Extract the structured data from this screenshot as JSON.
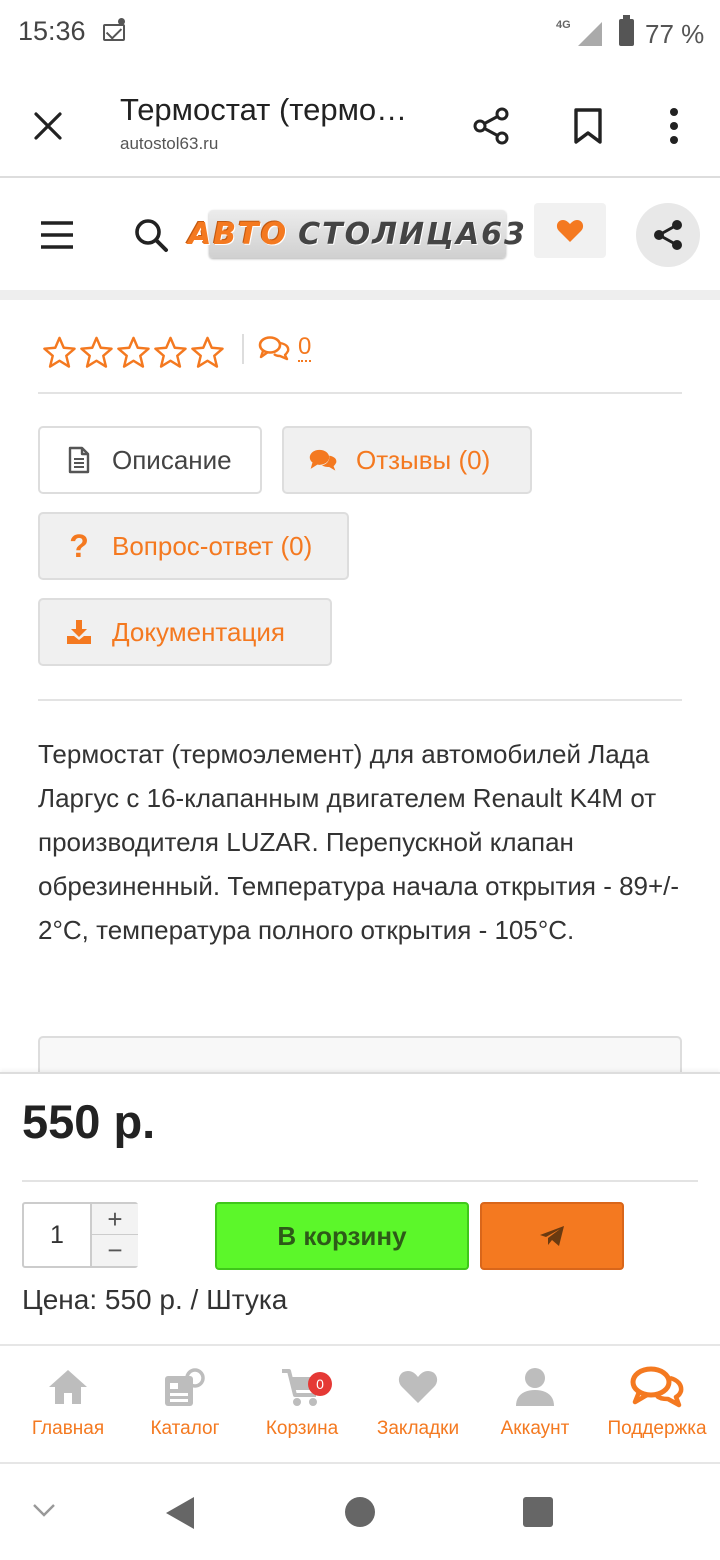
{
  "status_bar": {
    "time": "15:36",
    "network": "4G",
    "battery_percent": "77 %"
  },
  "browser": {
    "page_title": "Термостат (термо…",
    "domain": "autostol63.ru",
    "close_icon": "close-icon",
    "share_icon": "share-icon",
    "bookmark_icon": "bookmark-icon",
    "menu_icon": "more-vert-icon"
  },
  "site_header": {
    "logo_part1": "АВТО",
    "logo_part2": "СТОЛИЦА63",
    "accent_color": "#f47920"
  },
  "rating": {
    "stars_filled": 0,
    "stars_total": 5,
    "comments_count": "0"
  },
  "tabs": {
    "description": "Описание",
    "reviews": "Отзывы (0)",
    "qa": "Вопрос-ответ (0)",
    "docs": "Документация"
  },
  "description": "Термостат (термоэлемент) для автомобилей Лада Ларгус с 16-клапанным двигателем Renault K4M от производителя LUZAR. Перепускной клапан обрезиненный. Температура начала открытия - 89+/- 2°C, температура полного открытия - 105°C.",
  "buy_panel": {
    "price": "550 р.",
    "quantity": "1",
    "plus": "+",
    "minus": "−",
    "add_to_cart": "В корзину",
    "unit_price": "Цена: 550 р. / Штука",
    "cart_button_color": "#5cf72a",
    "send_button_color": "#f47920"
  },
  "bottom_nav": {
    "home": "Главная",
    "catalog": "Каталог",
    "cart": "Корзина",
    "cart_badge": "0",
    "bookmarks": "Закладки",
    "account": "Аккаунт",
    "support": "Поддержка"
  }
}
